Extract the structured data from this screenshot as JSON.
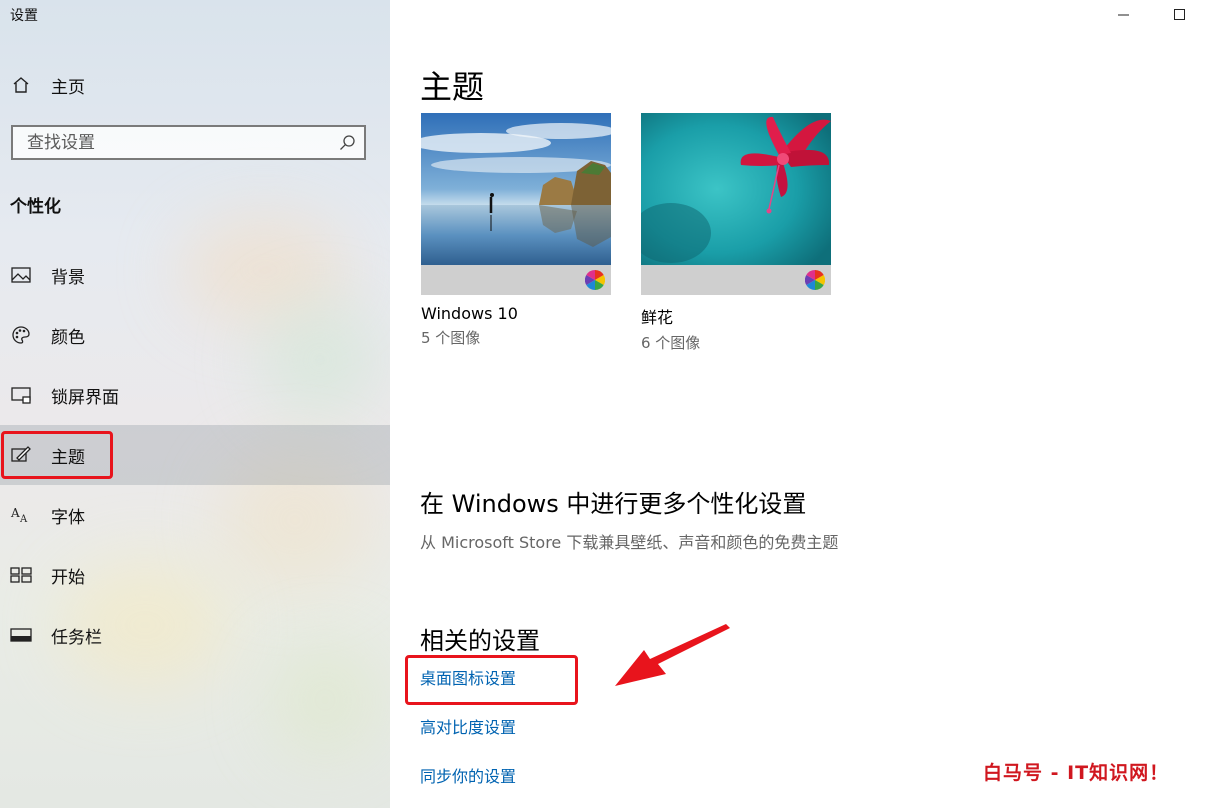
{
  "window": {
    "title": "设置"
  },
  "sidebar": {
    "home_label": "主页",
    "search_placeholder": "查找设置",
    "section_title": "个性化",
    "items": [
      {
        "label": "背景",
        "icon": "picture-icon"
      },
      {
        "label": "颜色",
        "icon": "palette-icon"
      },
      {
        "label": "锁屏界面",
        "icon": "lock-screen-icon"
      },
      {
        "label": "主题",
        "icon": "theme-brush-icon",
        "selected": true
      },
      {
        "label": "字体",
        "icon": "font-icon"
      },
      {
        "label": "开始",
        "icon": "start-icon"
      },
      {
        "label": "任务栏",
        "icon": "taskbar-icon"
      }
    ]
  },
  "main": {
    "title": "主题",
    "themes": [
      {
        "name": "Windows 10",
        "count": "5 个图像"
      },
      {
        "name": "鲜花",
        "count": "6 个图像"
      }
    ],
    "more": {
      "title": "在 Windows 中进行更多个性化设置",
      "desc": "从 Microsoft Store 下载兼具壁纸、声音和颜色的免费主题"
    },
    "related": {
      "title": "相关的设置",
      "links": [
        "桌面图标设置",
        "高对比度设置",
        "同步你的设置"
      ]
    }
  },
  "annotations": {
    "highlight_color": "#e8141c"
  },
  "watermark": "白马号 - IT知识网！",
  "colors": {
    "link": "#0063b1",
    "accent_red": "#e8141c"
  }
}
